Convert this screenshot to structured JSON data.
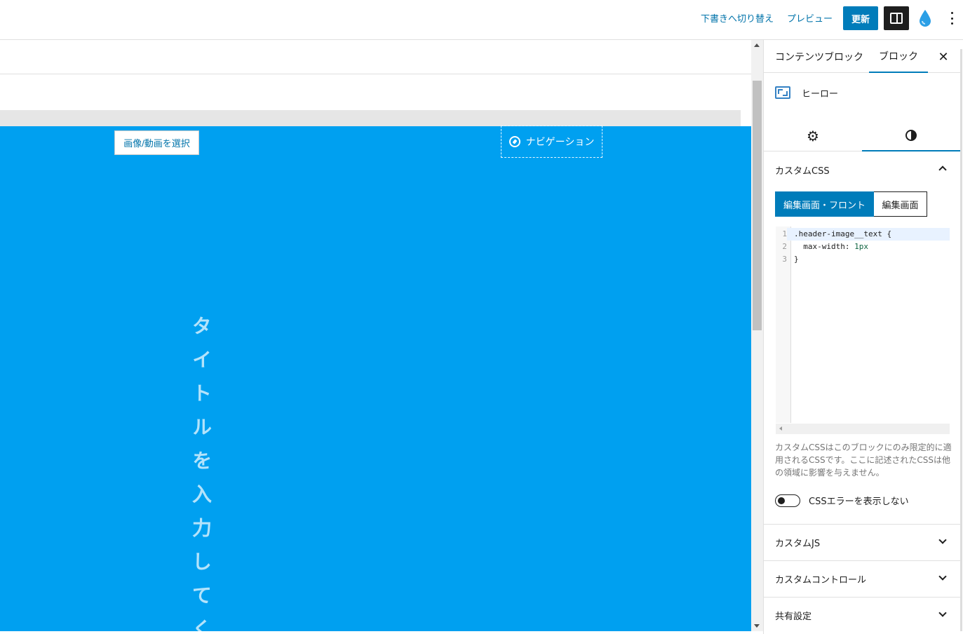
{
  "topbar": {
    "draft_label": "下書きへ切り替え",
    "preview_label": "プレビュー",
    "update_label": "更新"
  },
  "canvas": {
    "media_button": "画像/動画を選択",
    "navigation_label": "ナビゲーション",
    "hero_title": "タイトルを入力してく",
    "hero_color": "#00a0f0"
  },
  "sidebar": {
    "tabs": {
      "document": "コンテンツブロック",
      "block": "ブロック"
    },
    "block_name": "ヒーロー",
    "custom_css": {
      "title": "カスタムCSS",
      "mode_both": "編集画面・フロント",
      "mode_editor": "編集画面",
      "code_lines": [
        {
          "no": "1",
          "text": ".header-image__text {"
        },
        {
          "no": "2",
          "text": "  max-width: ",
          "num": "1px"
        },
        {
          "no": "3",
          "text": "}"
        }
      ],
      "help": "カスタムCSSはこのブロックにのみ限定的に適用されるCSSです。ここに記述されたCSSは他の領域に影響を与えません。",
      "toggle_label": "CSSエラーを表示しない"
    },
    "panels": {
      "custom_js": "カスタムJS",
      "custom_control": "カスタムコントロール",
      "shared": "共有設定"
    }
  },
  "colors": {
    "accent": "#007cba",
    "link": "#0073aa"
  }
}
